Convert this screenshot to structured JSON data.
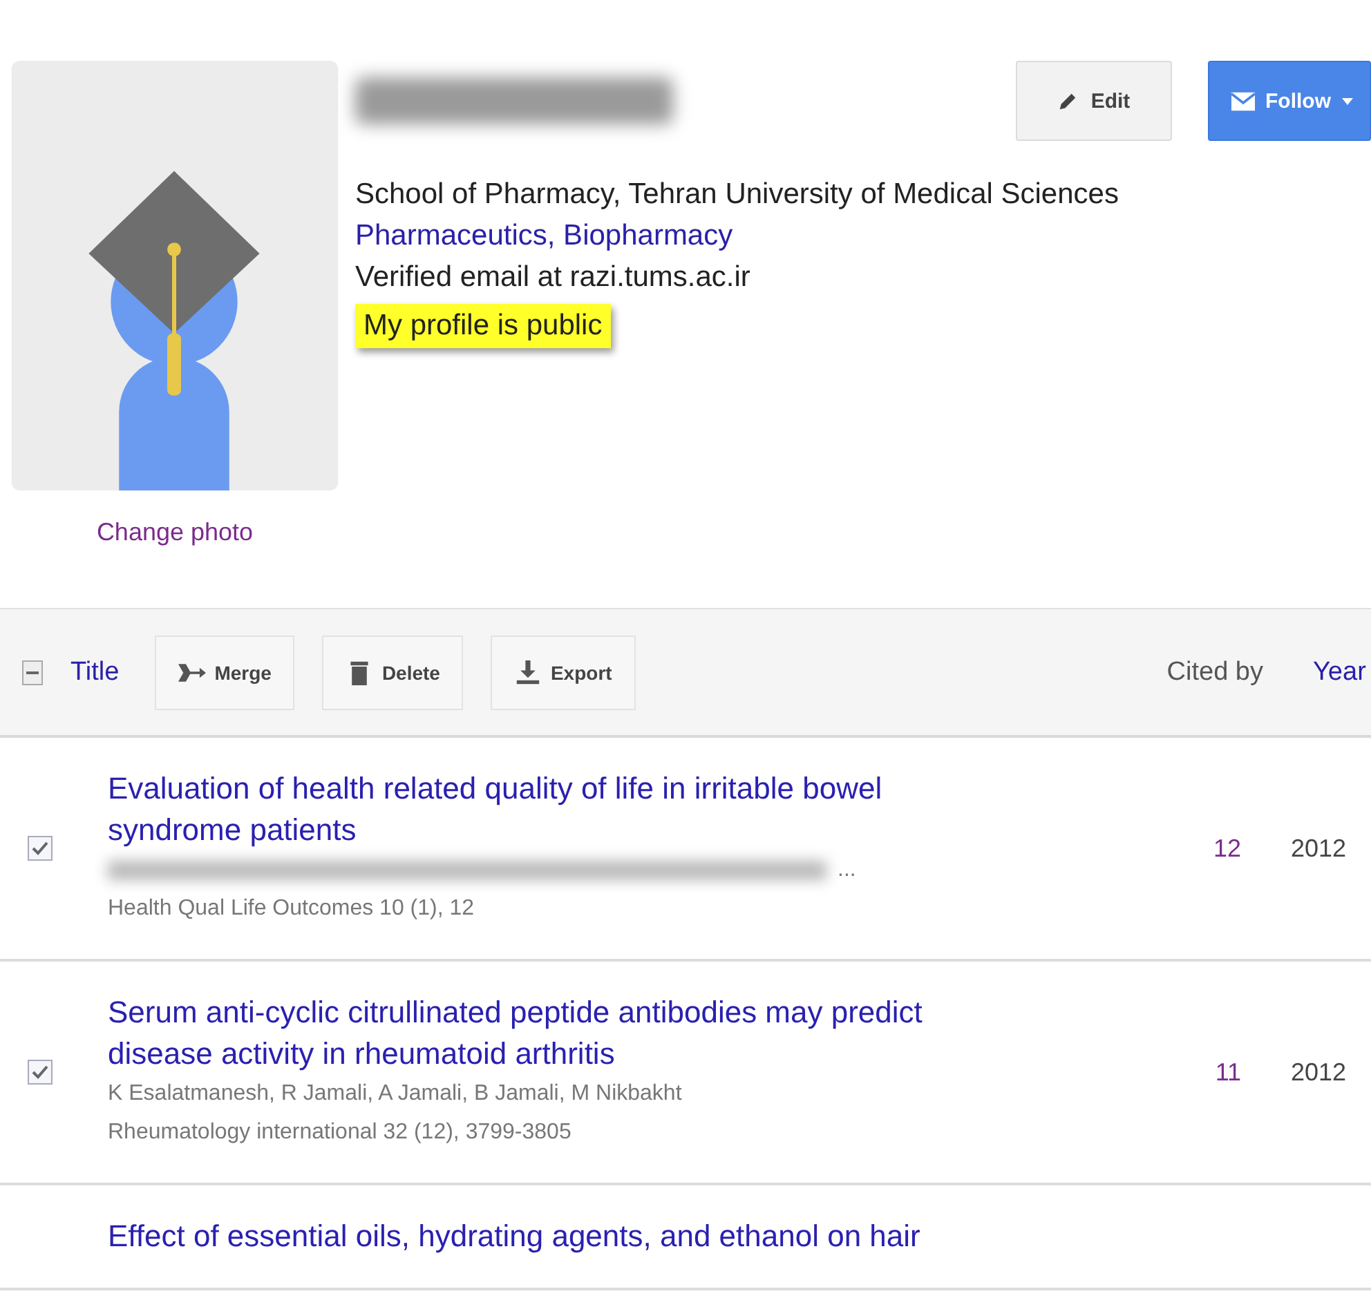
{
  "profile": {
    "affiliation": "School of Pharmacy, Tehran University of Medical Sciences",
    "interests": "Pharmaceutics, Biopharmacy",
    "email": "Verified email at razi.tums.ac.ir",
    "visibility": "My profile is public",
    "change_photo": "Change photo"
  },
  "actions": [
    {
      "kind": "edit",
      "label": "Edit"
    },
    {
      "kind": "follow",
      "label": "Follow"
    }
  ],
  "table": {
    "select_all": {
      "checked": true
    },
    "title_column": "Title",
    "tools": [
      {
        "kind": "merge",
        "label": "Merge"
      },
      {
        "kind": "delete",
        "label": "Delete"
      },
      {
        "kind": "export",
        "label": "Export"
      }
    ],
    "cited_by_column": "Cited by",
    "year_column": "Year",
    "rows": [
      {
        "checked": true,
        "title": "Evaluation of health related quality of life in irritable bowel syndrome patients",
        "authors_hidden": true,
        "authors": "...",
        "source": "Health Qual Life Outcomes 10 (1), 12",
        "cited_by": "12",
        "year": "2012"
      },
      {
        "checked": true,
        "title": "Serum anti-cyclic citrullinated peptide antibodies may predict disease activity in rheumatoid arthritis",
        "authors_hidden": false,
        "authors": "K Esalatmanesh, R Jamali, A Jamali, B Jamali, M Nikbakht",
        "source": "Rheumatology international 32 (12), 3799-3805",
        "cited_by": "11",
        "year": "2012"
      },
      {
        "title": "Effect of essential oils, hydrating agents, and ethanol on hair"
      }
    ]
  }
}
